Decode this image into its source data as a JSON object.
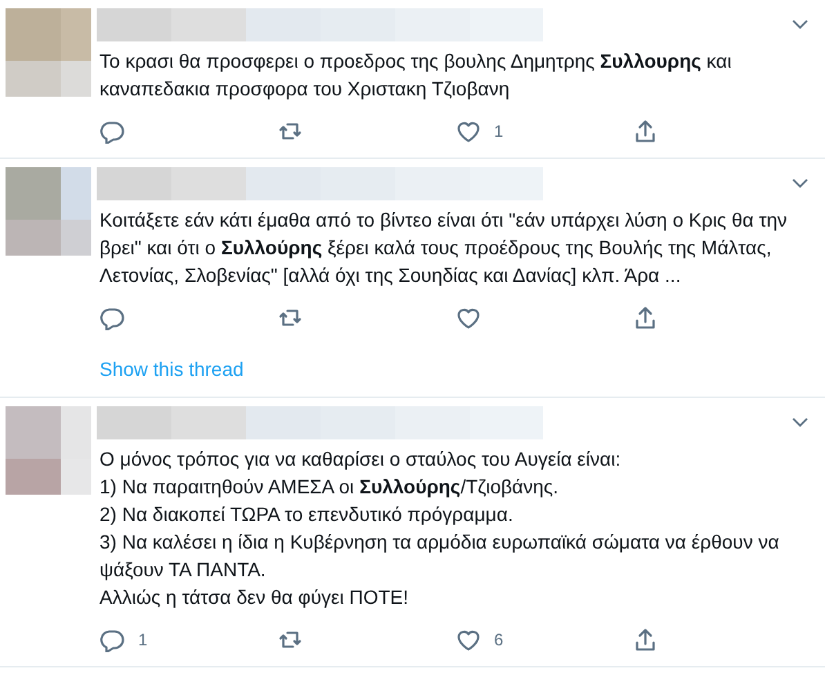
{
  "tweets": [
    {
      "text": [
        "Το κρασι θα προσφερει ο προεδρος της βουλης Δημητρης **Συλλουρης** και καναπεδακια προσφορα του Χριστακη Τζιοβανη"
      ],
      "actions": [
        {
          "kind": "reply"
        },
        {
          "kind": "retweet"
        },
        {
          "kind": "like",
          "count": "1"
        },
        {
          "kind": "share"
        }
      ]
    },
    {
      "text": [
        "Κοιτάξετε εάν κάτι έμαθα από το βίντεο είναι ότι \"εάν υπάρχει λύση ο Κρις θα την βρει\" και ότι ο **Συλλούρης** ξέρει καλά τους προέδρους της Βουλής της Μάλτας, Λετονίας, Σλοβενίας\" [αλλά όχι της Σουηδίας και Δανίας] κλπ. Άρα ..."
      ],
      "actions": [
        {
          "kind": "reply"
        },
        {
          "kind": "retweet"
        },
        {
          "kind": "like"
        },
        {
          "kind": "share"
        }
      ],
      "show_thread": "Show this thread"
    },
    {
      "text": [
        "Ο μόνος τρόπος για να καθαρίσει ο σταύλος του Αυγεία είναι:",
        "1) Να παραιτηθούν ΑΜΕΣΑ οι **Συλλούρης**/Τζιοβάνης.",
        "2) Να διακοπεί ΤΩΡΑ το επενδυτικό πρόγραμμα.",
        "3) Να καλέσει η ίδια η Κυβέρνηση τα αρμόδια ευρωπαϊκά σώματα να έρθουν να ψάξουν ΤΑ ΠΑΝΤΑ.",
        "Αλλιώς η τάτσα δεν θα φύγει ΠΟΤΕ!"
      ],
      "actions": [
        {
          "kind": "reply",
          "count": "1"
        },
        {
          "kind": "retweet"
        },
        {
          "kind": "like",
          "count": "6"
        },
        {
          "kind": "share"
        }
      ]
    }
  ]
}
